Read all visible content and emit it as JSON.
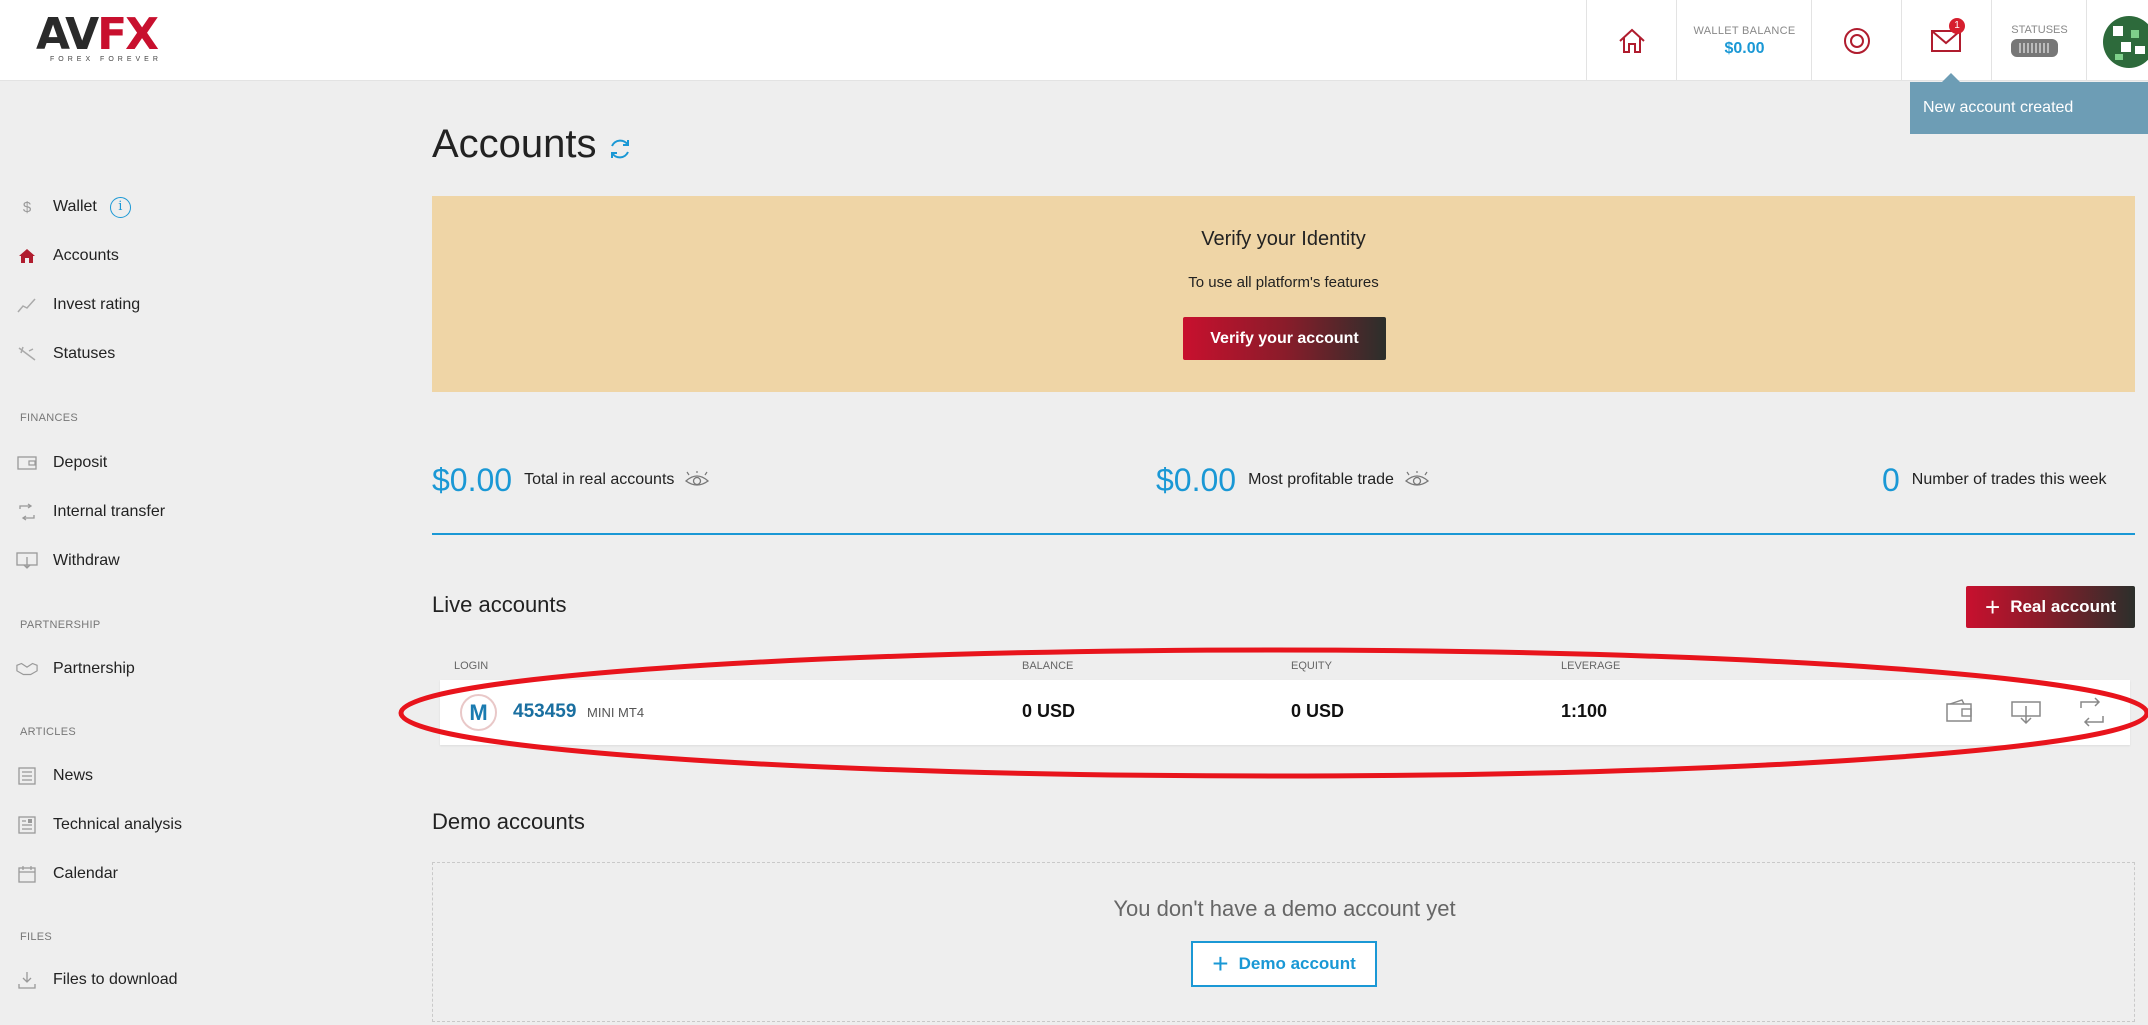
{
  "brand": {
    "logo_text_a": "AV",
    "logo_text_b": "FX",
    "tagline": "FOREX FOREVER"
  },
  "header": {
    "wallet_label": "WALLET BALANCE",
    "wallet_value": "$0.00",
    "mail_count": "1",
    "statuses_label": "STATUSES"
  },
  "tooltip": "New account created",
  "sidebar": {
    "main": [
      {
        "label": "Wallet",
        "icon": "dollar-icon"
      },
      {
        "label": "Accounts",
        "icon": "home-icon"
      },
      {
        "label": "Invest rating",
        "icon": "chart-line-icon"
      },
      {
        "label": "Statuses",
        "icon": "statuses-icon"
      }
    ],
    "sections": {
      "finances": "FINANCES",
      "partnership": "PARTNERSHIP",
      "articles": "ARTICLES",
      "files": "FILES"
    },
    "finances": [
      {
        "label": "Deposit",
        "icon": "wallet-icon"
      },
      {
        "label": "Internal transfer",
        "icon": "transfer-icon"
      },
      {
        "label": "Withdraw",
        "icon": "withdraw-icon"
      }
    ],
    "partnership": [
      {
        "label": "Partnership",
        "icon": "handshake-icon"
      }
    ],
    "articles": [
      {
        "label": "News",
        "icon": "news-icon"
      },
      {
        "label": "Technical analysis",
        "icon": "analysis-icon"
      },
      {
        "label": "Calendar",
        "icon": "calendar-icon"
      }
    ],
    "files": [
      {
        "label": "Files to download",
        "icon": "download-icon"
      }
    ]
  },
  "page": {
    "title": "Accounts"
  },
  "verify": {
    "title": "Verify your Identity",
    "subtitle": "To use all platform's features",
    "button": "Verify your account"
  },
  "stats": [
    {
      "value": "$0.00",
      "label": "Total in real accounts"
    },
    {
      "value": "$0.00",
      "label": "Most profitable trade"
    },
    {
      "value": "0",
      "label": "Number of trades this week"
    }
  ],
  "live": {
    "title": "Live accounts",
    "add_button": "Real account",
    "columns": {
      "login": "LOGIN",
      "balance": "BALANCE",
      "equity": "EQUITY",
      "leverage": "LEVERAGE"
    },
    "rows": [
      {
        "badge": "M",
        "login": "453459",
        "type": "MINI MT4",
        "balance": "0 USD",
        "equity": "0 USD",
        "leverage": "1:100"
      }
    ]
  },
  "demo": {
    "title": "Demo accounts",
    "empty": "You don't have a demo account yet",
    "add_button": "Demo account"
  },
  "colors": {
    "accent": "#1a98d5",
    "brand_red": "#c8102e",
    "banner": "#efd5a6",
    "tooltip": "#6d9db5"
  }
}
